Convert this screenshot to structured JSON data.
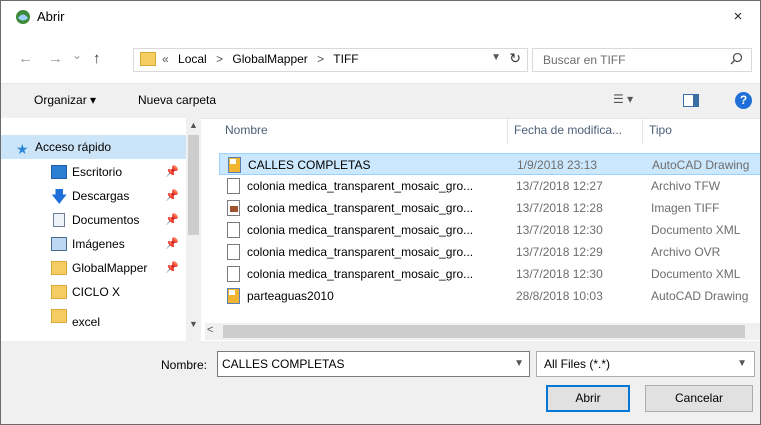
{
  "window": {
    "title": "Abrir",
    "close_glyph": "×"
  },
  "nav": {
    "back_glyph": "←",
    "forward_glyph": "→",
    "recent_glyph": "⌄",
    "up_glyph": "↑",
    "breadcrumbs": [
      "«",
      "Local",
      ">",
      "GlobalMapper",
      ">",
      "TIFF"
    ],
    "search_placeholder": "Buscar en TIFF"
  },
  "toolbar": {
    "organize_label": "Organizar ▾",
    "new_folder_label": "Nueva carpeta",
    "help_label": "?"
  },
  "sidebar": {
    "items": [
      {
        "label": "Acceso rápido",
        "icon": "star-icon",
        "pinned": false
      },
      {
        "label": "Escritorio",
        "icon": "desktop-icon",
        "pinned": true
      },
      {
        "label": "Descargas",
        "icon": "download-icon",
        "pinned": true
      },
      {
        "label": "Documentos",
        "icon": "documents-icon",
        "pinned": true
      },
      {
        "label": "Imágenes",
        "icon": "pictures-icon",
        "pinned": true
      },
      {
        "label": "GlobalMapper",
        "icon": "folder-icon",
        "pinned": true
      },
      {
        "label": "CICLO X",
        "icon": "folder-icon",
        "pinned": false
      },
      {
        "label": "excel",
        "icon": "folder-icon",
        "pinned": false
      }
    ]
  },
  "filelist": {
    "columns": [
      "Nombre",
      "Fecha de modifica...",
      "Tipo"
    ],
    "rows": [
      {
        "name": "CALLES COMPLETAS",
        "date": "1/9/2018 23:13",
        "type": "AutoCAD Drawing",
        "icon": "autocad-icon",
        "selected": true
      },
      {
        "name": "colonia medica_transparent_mosaic_gro...",
        "date": "13/7/2018 12:27",
        "type": "Archivo TFW",
        "icon": "file-icon",
        "selected": false
      },
      {
        "name": "colonia medica_transparent_mosaic_gro...",
        "date": "13/7/2018 12:28",
        "type": "Imagen TIFF",
        "icon": "image-icon",
        "selected": false
      },
      {
        "name": "colonia medica_transparent_mosaic_gro...",
        "date": "13/7/2018 12:30",
        "type": "Documento XML",
        "icon": "file-icon",
        "selected": false
      },
      {
        "name": "colonia medica_transparent_mosaic_gro...",
        "date": "13/7/2018 12:29",
        "type": "Archivo OVR",
        "icon": "file-icon",
        "selected": false
      },
      {
        "name": "colonia medica_transparent_mosaic_gro...",
        "date": "13/7/2018 12:30",
        "type": "Documento XML",
        "icon": "file-icon",
        "selected": false
      },
      {
        "name": "parteaguas2010",
        "date": "28/8/2018 10:03",
        "type": "AutoCAD Drawing",
        "icon": "autocad-icon",
        "selected": false
      }
    ]
  },
  "footer": {
    "name_label": "Nombre:",
    "name_value": "CALLES COMPLETAS",
    "filter_value": "All Files (*.*)",
    "open_label": "Abrir",
    "cancel_label": "Cancelar"
  }
}
